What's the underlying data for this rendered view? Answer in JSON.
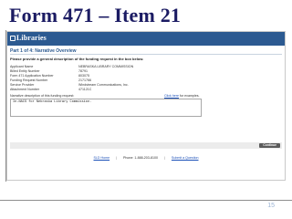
{
  "slide": {
    "title": "Form 471 – Item 21",
    "number": "15"
  },
  "app": {
    "logo_text": "Libraries",
    "section_title": "Part 1 of 4: Narrative Overview",
    "instructions": "Please provide a general description of the funding request in the box below."
  },
  "details": [
    {
      "label": "Applicant Name",
      "value": "NEBRASKA LIBRARY COMMISSION"
    },
    {
      "label": "Billed Entity Number",
      "value": "78791"
    },
    {
      "label": "Form 471 Application Number",
      "value": "803075"
    },
    {
      "label": "Funding Request Number",
      "value": "2171766"
    },
    {
      "label": "Service Provider",
      "value": "Windstream Communications, Inc."
    },
    {
      "label": "Attachment Number",
      "value": "471121C"
    }
  ],
  "narrative": {
    "label": "Narrative description of this funding request:",
    "example_link": "Click here",
    "example_suffix": "for examples.",
    "value": "In-NACS for Nebraska Library Commission."
  },
  "continue_label": "Continue",
  "footer": {
    "faq": "SLD Home",
    "phone": "Phone: 1-888-203-8100",
    "submit": "Submit a Question"
  },
  "colors": {
    "header_bg": "#2c5a91",
    "title_text": "#1b1b63",
    "link": "#1a4fb8",
    "continue_button": "#5b5b5b"
  }
}
